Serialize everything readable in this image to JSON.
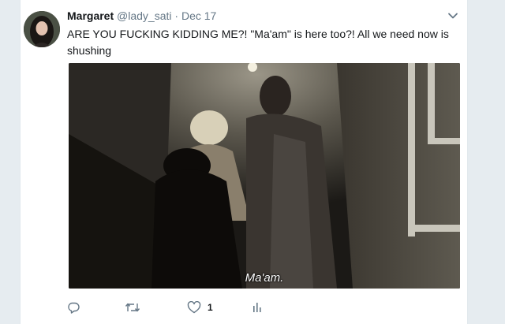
{
  "tweet": {
    "author_name": "Margaret",
    "handle": "@lady_sati",
    "separator": "·",
    "date": "Dec 17",
    "text": "ARE YOU FUCKING KIDDING ME?! \"Ma'am\" is here too?! All we need now is shushing",
    "media": {
      "subtitle": "Ma'am."
    },
    "actions": {
      "like_count": "1"
    }
  },
  "icons": [
    "reply-icon",
    "retweet-icon",
    "heart-icon",
    "analytics-icon",
    "chevron-down-icon"
  ],
  "colors": {
    "page_background": "#e6ecf0",
    "card_background": "#ffffff",
    "meta_text": "#657786",
    "icon": "#657786"
  }
}
